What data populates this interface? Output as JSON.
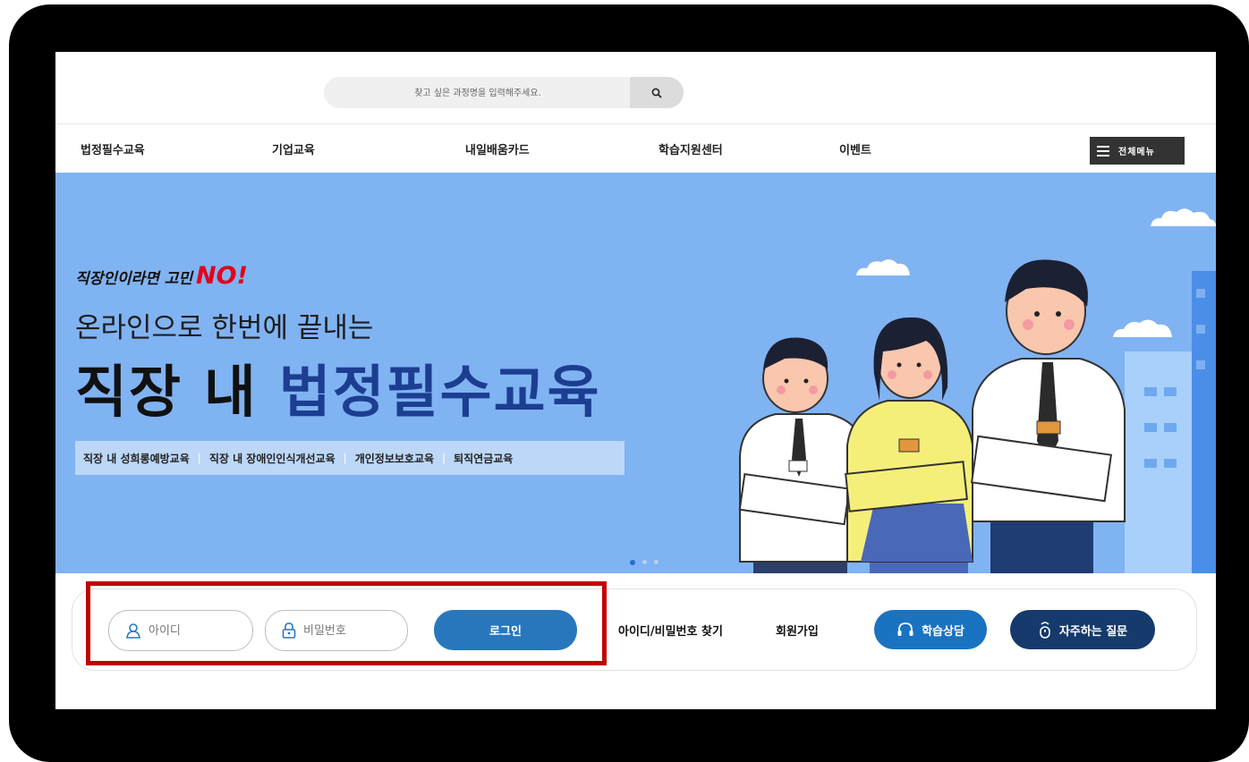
{
  "search": {
    "placeholder": "찾고 싶은 과정명을 입력해주세요.",
    "icon": "search-icon"
  },
  "nav": {
    "items": [
      "법정필수교육",
      "기업교육",
      "내일배움카드",
      "학습지원센터",
      "이벤트"
    ],
    "all_menu_label": "전체메뉴"
  },
  "banner": {
    "tagline": "직장인이라면 고민",
    "tagline_emphasis": "NO!",
    "sub_heading": "온라인으로 한번에 끝내는",
    "main_heading_prefix": "직장 내",
    "main_heading_highlight": "법정필수교육",
    "courses": [
      "직장 내 성희롱예방교육",
      "직장 내 장애인인식개선교육",
      "개인정보보호교육",
      "퇴직연금교육"
    ],
    "course_separator": "|",
    "slide_count": 3,
    "active_slide": 1
  },
  "login": {
    "id_placeholder": "아이디",
    "pw_placeholder": "비밀번호",
    "login_label": "로그인",
    "find_label": "아이디/비밀번호 찾기",
    "join_label": "회원가입",
    "consult_label": "학습상담",
    "faq_label": "자주하는 질문"
  },
  "colors": {
    "banner_bg": "#80b3f2",
    "accent_blue": "#2877bd",
    "consult_blue": "#1a73c0",
    "faq_navy": "#153a6b",
    "highlight_red": "#c00000",
    "no_red": "#e3001b"
  }
}
